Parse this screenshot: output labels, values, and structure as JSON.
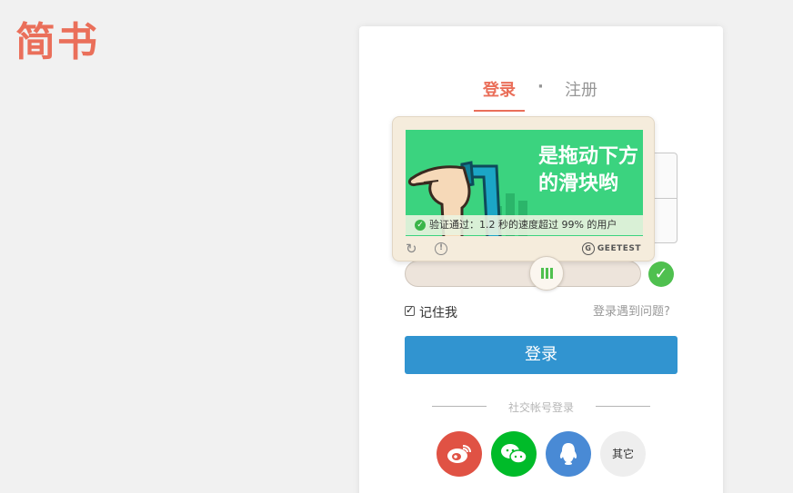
{
  "brand": {
    "logo": "简书"
  },
  "tabs": {
    "login": "登录",
    "separator": "·",
    "register": "注册"
  },
  "captcha": {
    "image_text": "是拖动下方的滑块哟",
    "result_text": "验证通过：1.2 秒的速度超过 99% 的用户",
    "brand": "GEETEST",
    "refresh_icon": "refresh-icon",
    "info_icon": "info-icon",
    "slider_progress": 0.55,
    "status": "passed"
  },
  "form": {
    "remember_label": "记住我",
    "remember_checked": true,
    "trouble_link": "登录遇到问题?",
    "submit_label": "登录"
  },
  "social": {
    "title": "社交帐号登录",
    "providers": [
      {
        "name": "weibo",
        "icon": "weibo-icon",
        "color": "#e05244"
      },
      {
        "name": "wechat",
        "icon": "wechat-icon",
        "color": "#00bb29"
      },
      {
        "name": "qq",
        "icon": "qq-icon",
        "color": "#498ad5"
      }
    ],
    "other_label": "其它"
  },
  "colors": {
    "accent": "#ea6f5a",
    "primary": "#3194d0",
    "success": "#4fc04f"
  }
}
